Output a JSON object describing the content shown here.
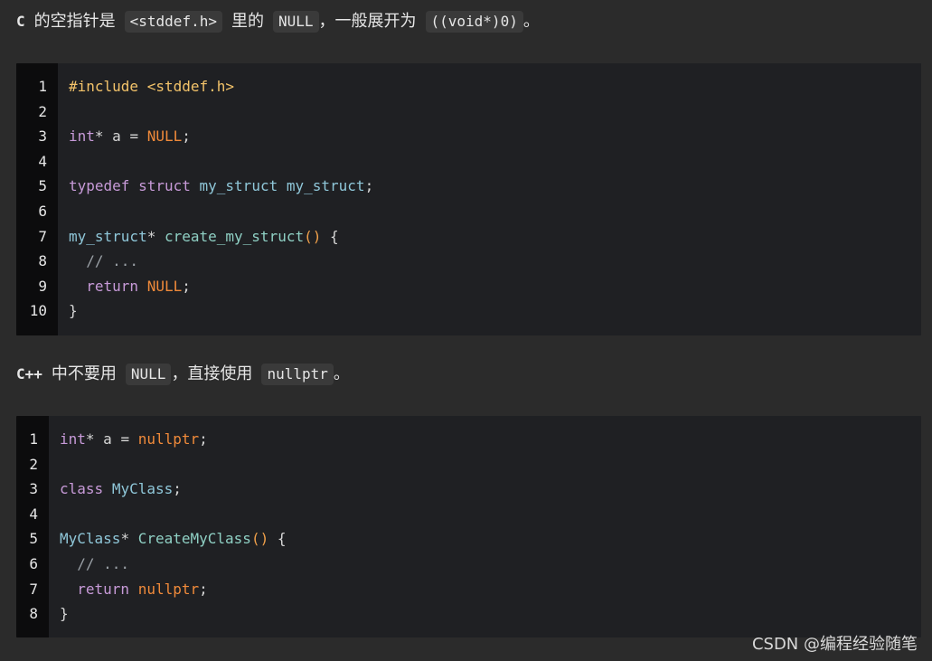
{
  "para1": {
    "lead": "C",
    "t1": "的空指针是",
    "c1": "<stddef.h>",
    "t2": "里的",
    "c2": "NULL",
    "t3": "，一般展开为",
    "c3": "((void*)0)",
    "t4": "。"
  },
  "code1": {
    "line_numbers": [
      "1",
      "2",
      "3",
      "4",
      "5",
      "6",
      "7",
      "8",
      "9",
      "10"
    ],
    "lines": [
      [
        {
          "t": "#include <stddef.h>",
          "k": "pp"
        }
      ],
      [],
      [
        {
          "t": "int",
          "k": "kw"
        },
        {
          "t": "* a = ",
          "k": "txt"
        },
        {
          "t": "NULL",
          "k": "null"
        },
        {
          "t": ";",
          "k": "txt"
        }
      ],
      [],
      [
        {
          "t": "typedef",
          "k": "kw"
        },
        {
          "t": " ",
          "k": "txt"
        },
        {
          "t": "struct",
          "k": "kw"
        },
        {
          "t": " ",
          "k": "txt"
        },
        {
          "t": "my_struct",
          "k": "type"
        },
        {
          "t": " ",
          "k": "txt"
        },
        {
          "t": "my_struct",
          "k": "type"
        },
        {
          "t": ";",
          "k": "txt"
        }
      ],
      [],
      [
        {
          "t": "my_struct",
          "k": "type"
        },
        {
          "t": "* ",
          "k": "txt"
        },
        {
          "t": "create_my_struct",
          "k": "fn"
        },
        {
          "t": "()",
          "k": "paren"
        },
        {
          "t": " {",
          "k": "txt"
        }
      ],
      [
        {
          "t": "  // ...",
          "k": "cm"
        }
      ],
      [
        {
          "t": "  ",
          "k": "txt"
        },
        {
          "t": "return",
          "k": "kw"
        },
        {
          "t": " ",
          "k": "txt"
        },
        {
          "t": "NULL",
          "k": "null"
        },
        {
          "t": ";",
          "k": "txt"
        }
      ],
      [
        {
          "t": "}",
          "k": "txt"
        }
      ]
    ]
  },
  "para2": {
    "lead": "C++",
    "t1": "中不要用",
    "c1": "NULL",
    "t2": "，直接使用",
    "c2": "nullptr",
    "t3": "。"
  },
  "code2": {
    "line_numbers": [
      "1",
      "2",
      "3",
      "4",
      "5",
      "6",
      "7",
      "8"
    ],
    "lines": [
      [
        {
          "t": "int",
          "k": "kw"
        },
        {
          "t": "* a = ",
          "k": "txt"
        },
        {
          "t": "nullptr",
          "k": "null"
        },
        {
          "t": ";",
          "k": "txt"
        }
      ],
      [],
      [
        {
          "t": "class",
          "k": "kw"
        },
        {
          "t": " ",
          "k": "txt"
        },
        {
          "t": "MyClass",
          "k": "type"
        },
        {
          "t": ";",
          "k": "txt"
        }
      ],
      [],
      [
        {
          "t": "MyClass",
          "k": "type"
        },
        {
          "t": "* ",
          "k": "txt"
        },
        {
          "t": "CreateMyClass",
          "k": "fn"
        },
        {
          "t": "()",
          "k": "paren"
        },
        {
          "t": " {",
          "k": "txt"
        }
      ],
      [
        {
          "t": "  // ...",
          "k": "cm"
        }
      ],
      [
        {
          "t": "  ",
          "k": "txt"
        },
        {
          "t": "return",
          "k": "kw"
        },
        {
          "t": " ",
          "k": "txt"
        },
        {
          "t": "nullptr",
          "k": "null"
        },
        {
          "t": ";",
          "k": "txt"
        }
      ],
      [
        {
          "t": "}",
          "k": "txt"
        }
      ]
    ]
  },
  "watermark": "CSDN @编程经验随笔",
  "colors": {
    "background": "#2b2b2b",
    "code_background": "#1f2023",
    "gutter_background": "#0c0c0d",
    "keyword": "#c79ad8",
    "preprocessor": "#f3c36a",
    "type": "#8fc7d9",
    "function": "#8fd0c4",
    "null_literal": "#f08a3a",
    "comment": "#9aa0a6"
  }
}
